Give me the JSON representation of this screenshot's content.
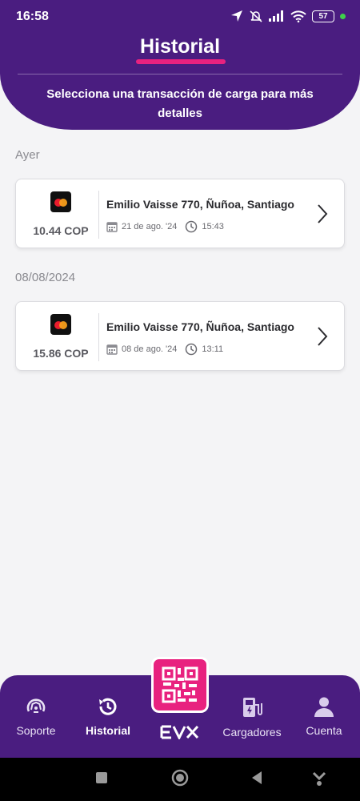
{
  "status_bar": {
    "time": "16:58",
    "battery": "57"
  },
  "header": {
    "title": "Historial",
    "subtitle": "Selecciona una transacción de carga para más detalles"
  },
  "sections": [
    {
      "label": "Ayer",
      "transaction": {
        "amount": "10.44 COP",
        "address": "Emilio Vaisse 770, Ñuñoa, Santiago",
        "date": "21 de ago. '24",
        "time": "15:43"
      }
    },
    {
      "label": "08/08/2024",
      "transaction": {
        "amount": "15.86 COP",
        "address": "Emilio Vaisse 770, Ñuñoa, Santiago",
        "date": "08 de ago. '24",
        "time": "13:11"
      }
    }
  ],
  "bottom_nav": {
    "items": [
      {
        "label": "Soporte",
        "icon": "support-icon"
      },
      {
        "label": "Historial",
        "icon": "history-icon",
        "active": true
      },
      {
        "label": "Cargadores",
        "icon": "charger-icon"
      },
      {
        "label": "Cuenta",
        "icon": "user-icon"
      }
    ],
    "center": {
      "icon": "qr-code-icon",
      "brand": "EVX"
    }
  },
  "colors": {
    "primary": "#4a1d80",
    "accent": "#e8227f"
  }
}
